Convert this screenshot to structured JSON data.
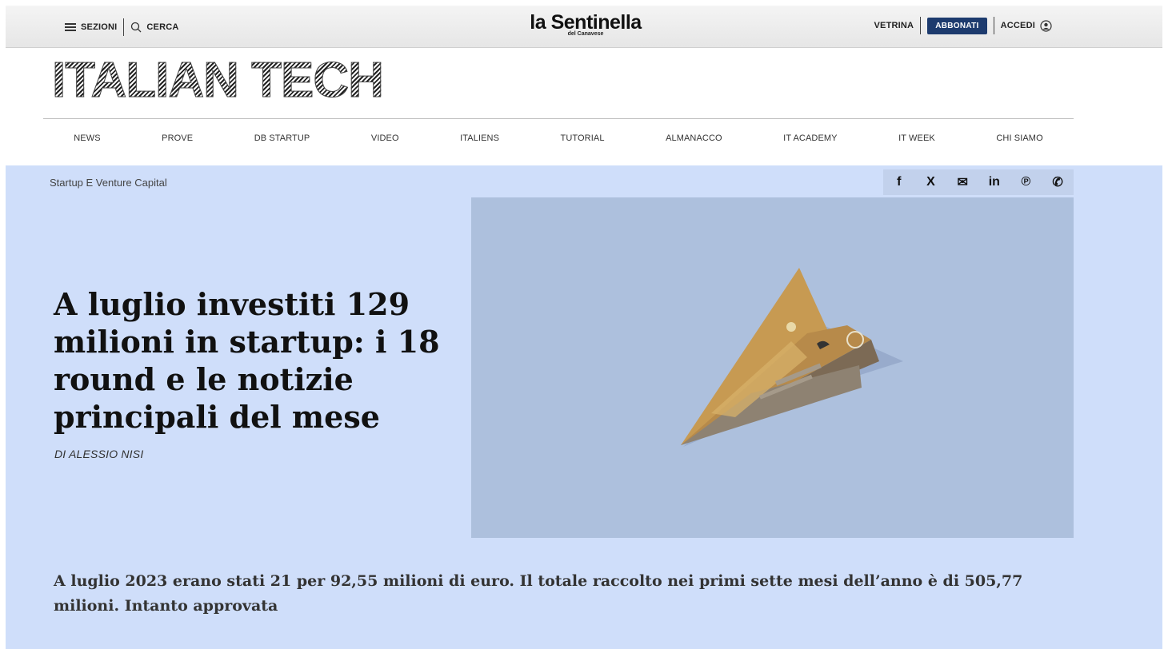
{
  "topbar": {
    "sections_label": "SEZIONI",
    "search_label": "CERCA",
    "logo_main": "la Sentinella",
    "logo_sub": "del Canavese",
    "showcase_label": "VETRINA",
    "subscribe_label": "ABBONATI",
    "login_label": "ACCEDI"
  },
  "brand": {
    "name": "ITALIAN TECH"
  },
  "nav": {
    "items": [
      {
        "label": "NEWS"
      },
      {
        "label": "PROVE"
      },
      {
        "label": "DB STARTUP"
      },
      {
        "label": "VIDEO"
      },
      {
        "label": "ITALIENS"
      },
      {
        "label": "TUTORIAL"
      },
      {
        "label": "ALMANACCO"
      },
      {
        "label": "IT ACADEMY"
      },
      {
        "label": "IT WEEK"
      },
      {
        "label": "CHI SIAMO"
      }
    ]
  },
  "article": {
    "section": "Startup E Venture Capital",
    "headline": "A luglio investiti 129 milioni in startup: i 18 round e le notizie principali del mese",
    "byline": "DI ALESSIO NISI",
    "lede": "A luglio 2023 erano stati 21 per 92,55 milioni di euro. Il totale raccolto nei primi sette mesi dell’anno è di 505,77 milioni. Intanto approvata",
    "image_subject": "paper-plane-banknote-image"
  },
  "share": {
    "icons": [
      "facebook-icon",
      "x-icon",
      "email-icon",
      "linkedin-icon",
      "pinterest-icon",
      "whatsapp-icon"
    ],
    "glyphs": [
      "f",
      "X",
      "✉",
      "in",
      "℗",
      "✆"
    ]
  },
  "colors": {
    "hero_bg": "#cfdefa",
    "image_bg": "#adc0dd",
    "subscribe_bg": "#1d3b6e"
  }
}
